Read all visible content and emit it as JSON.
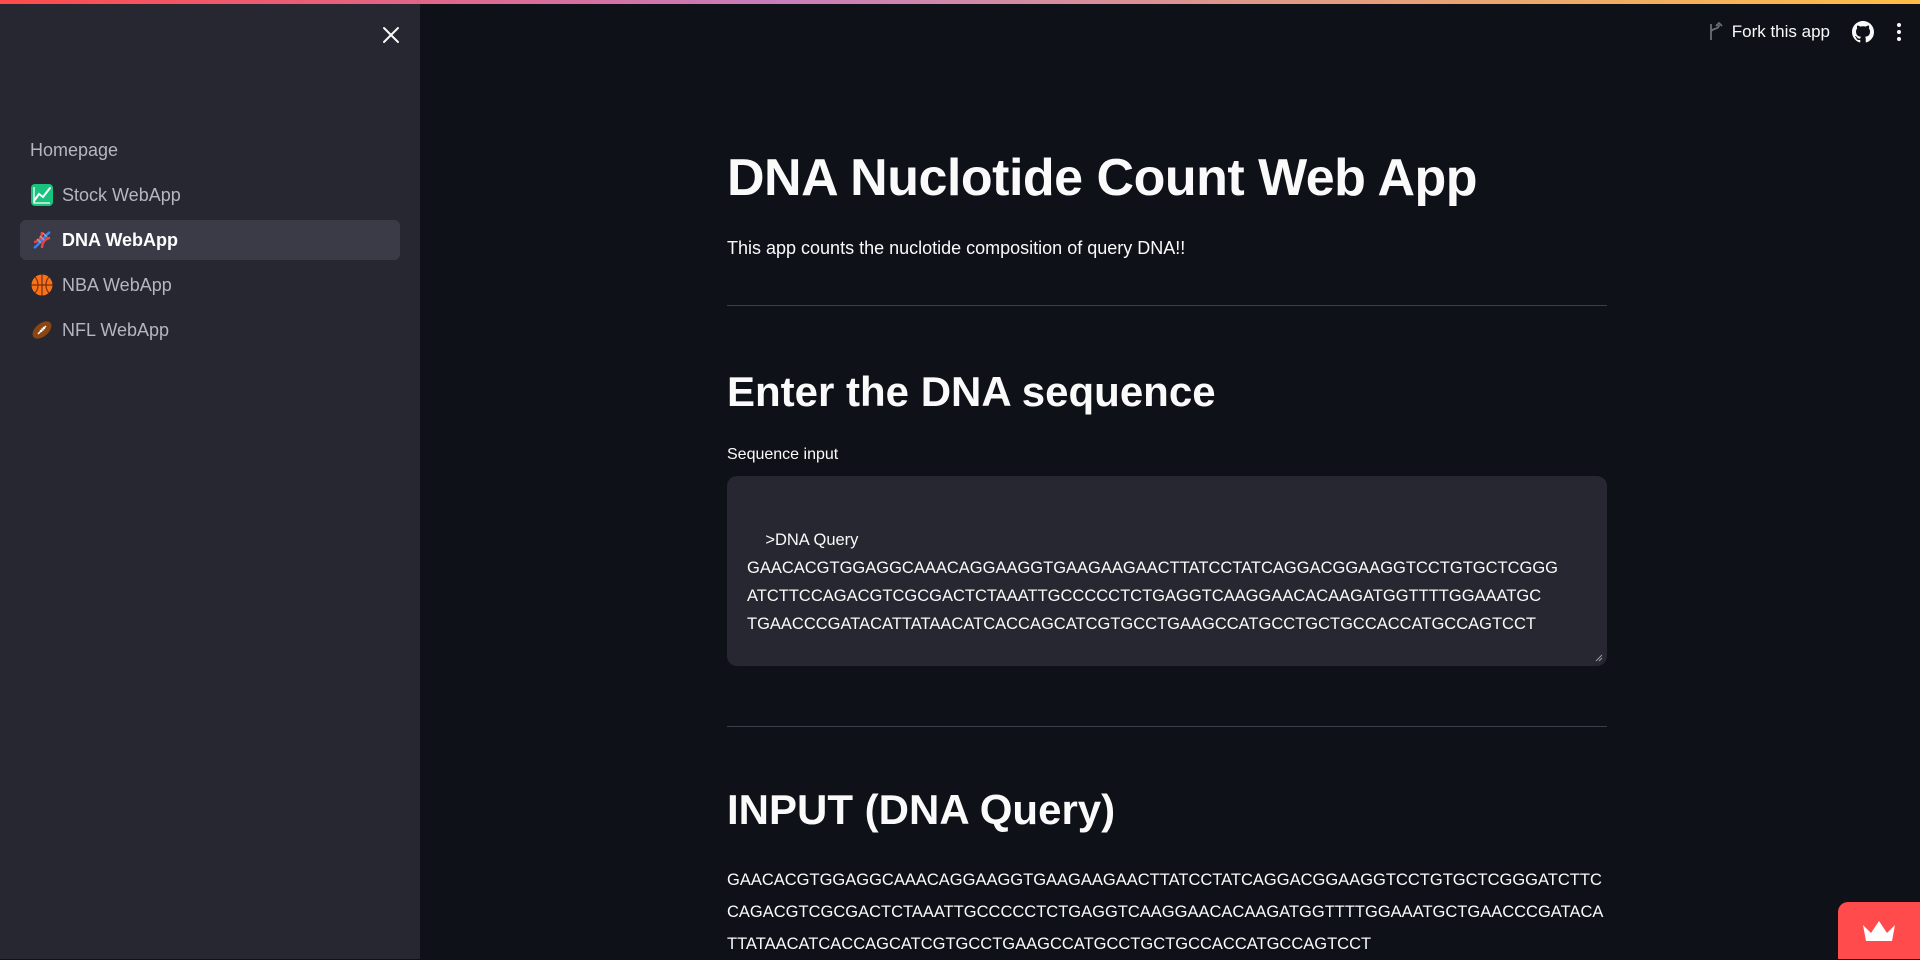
{
  "sidebar": {
    "close_label": "×",
    "items": [
      {
        "label": "Homepage",
        "icon": "home"
      },
      {
        "label": "Stock WebApp",
        "icon": "chart-increasing-icon"
      },
      {
        "label": "DNA WebApp",
        "icon": "dna-icon",
        "active": true
      },
      {
        "label": "NBA WebApp",
        "icon": "basketball-icon"
      },
      {
        "label": "NFL WebApp",
        "icon": "american-football-icon"
      }
    ]
  },
  "toolbar": {
    "fork_label": "Fork this app",
    "github_icon": "github-icon",
    "menu_icon": "kebab-menu-icon"
  },
  "main": {
    "title": "DNA Nuclotide Count Web App",
    "subtitle": "This app counts the nuclotide composition of query DNA!!",
    "section_input_heading": "Enter the DNA sequence",
    "input_label": "Sequence input",
    "input_value": ">DNA Query\nGAACACGTGGAGGCAAACAGGAAGGTGAAGAAGAACTTATCCTATCAGGACGGAAGGTCCTGTGCTCGGG\nATCTTCCAGACGTCGCGACTCTAAATTGCCCCCTCTGAGGTCAAGGAACACAAGATGGTTTTGGAAATGC\nTGAACCCGATACATTATAACATCACCAGCATCGTGCCTGAAGCCATGCCTGCTGCCACCATGCCAGTCCT",
    "section_output_heading": "INPUT (DNA Query)",
    "output_text": "GAACACGTGGAGGCAAACAGGAAGGTGAAGAAGAACTTATCCTATCAGGACGGAAGGTCCTGTGCTCGGGATCTTCCAGACGTCGCGACTCTAAATTGCCCCCTCTGAGGTCAAGGAACACAAGATGGTTTTGGAAATGCTGAACCCGATACATTATAACATCACCAGCATCGTGCCTGAAGCCATGCCTGCTGCCACCATGCCAGTCCT"
  },
  "colors": {
    "background": "#0e1117",
    "sidebar": "#262730",
    "accent": "#ff4b4b",
    "text": "#fafafa"
  }
}
